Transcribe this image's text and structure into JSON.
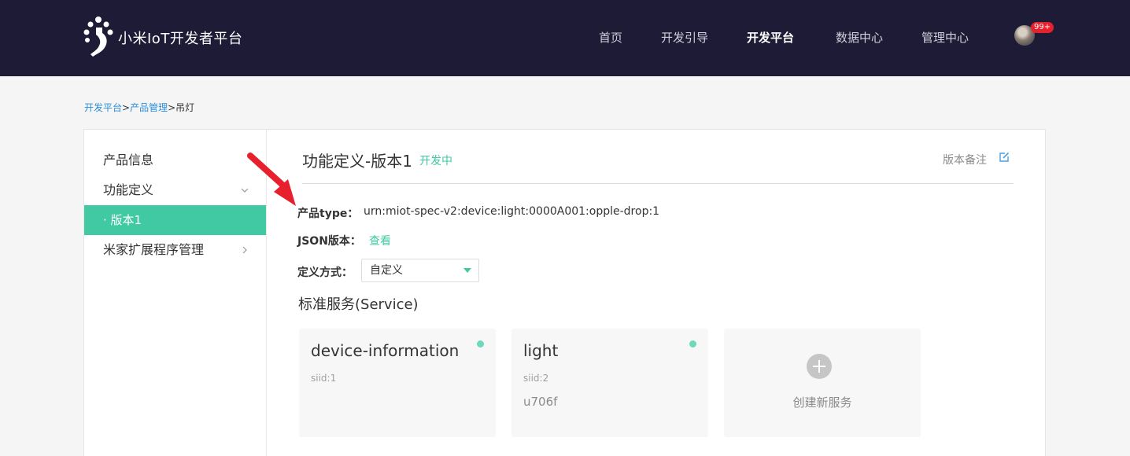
{
  "header": {
    "brand": "小米IoT开发者平台",
    "nav": [
      {
        "label": "首页",
        "active": false
      },
      {
        "label": "开发引导",
        "active": false
      },
      {
        "label": "开发平台",
        "active": true
      },
      {
        "label": "数据中心",
        "active": false
      },
      {
        "label": "管理中心",
        "active": false
      }
    ],
    "notification_badge": "99+"
  },
  "breadcrumb": {
    "items": [
      "开发平台",
      "产品管理"
    ],
    "separator": ">",
    "current": "吊灯"
  },
  "sidebar": {
    "items": [
      {
        "label": "产品信息",
        "expandable": false
      },
      {
        "label": "功能定义",
        "expandable": true,
        "expanded": true
      },
      {
        "label": "· 版本1",
        "active": true
      },
      {
        "label": "米家扩展程序管理",
        "expandable": true,
        "expanded": false
      }
    ]
  },
  "main": {
    "title": "功能定义-版本1",
    "status": "开发中",
    "version_note_label": "版本备注",
    "product_type_label": "产品type：",
    "product_type_value": "urn:miot-spec-v2:device:light:0000A001:opple-drop:1",
    "json_version_label": "JSON版本：",
    "json_version_link": "查看",
    "define_method_label": "定义方式：",
    "define_method_value": "自定义",
    "services_title": "标准服务(Service)",
    "services": [
      {
        "name": "device-information",
        "siid": "siid:1",
        "desc": ""
      },
      {
        "name": "light",
        "siid": "siid:2",
        "desc": "u706f"
      }
    ],
    "create_service_label": "创建新服务"
  },
  "colors": {
    "header_bg": "#1d1b35",
    "accent": "#40c9a2",
    "link": "#2a8dd6",
    "annotation_arrow": "#e8202e"
  }
}
